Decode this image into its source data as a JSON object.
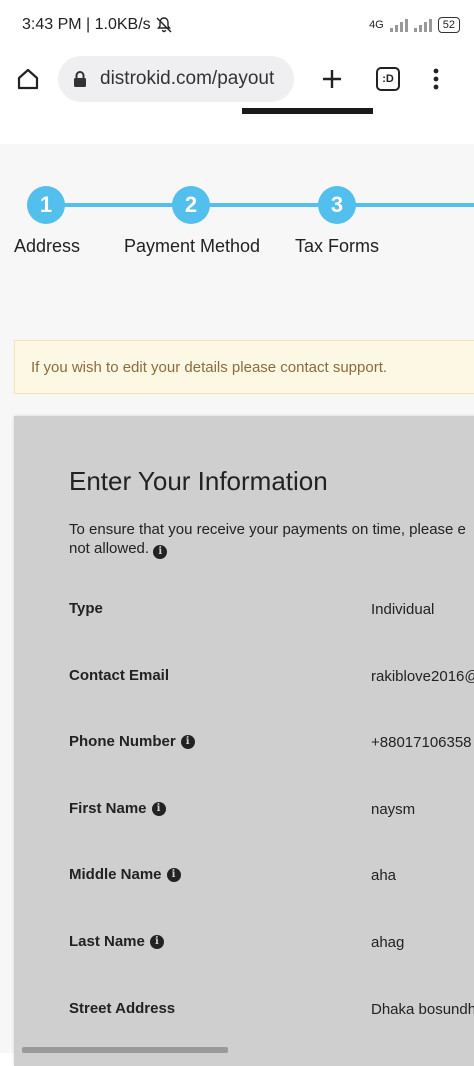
{
  "status_bar": {
    "time": "3:43 PM | 1.0KB/s",
    "network_label": "4G",
    "battery": "52"
  },
  "browser": {
    "url": "distrokid.com/payout",
    "tab_count_label": ":D"
  },
  "stepper": {
    "steps": [
      {
        "number": "1",
        "label": "Address"
      },
      {
        "number": "2",
        "label": "Payment Method"
      },
      {
        "number": "3",
        "label": "Tax Forms"
      }
    ]
  },
  "notice": {
    "text": "If you wish to edit your details please contact support."
  },
  "form": {
    "title": "Enter Your Information",
    "description": "To ensure that you receive your payments on time, please e not allowed.",
    "rows": [
      {
        "label": "Type",
        "value": "Individual"
      },
      {
        "label": "Contact Email",
        "value": "rakiblove2016@"
      },
      {
        "label": "Phone Number",
        "value": "+88017106358"
      },
      {
        "label": "First Name",
        "value": "naysm"
      },
      {
        "label": "Middle Name",
        "value": "aha"
      },
      {
        "label": "Last Name",
        "value": "ahag"
      },
      {
        "label": "Street Address",
        "value": "Dhaka bosundh"
      }
    ]
  },
  "colors": {
    "accent": "#52bfec",
    "notice_bg": "#fcf8e4",
    "notice_text": "#8a6d3b",
    "card_bg": "#cfcfcf"
  }
}
